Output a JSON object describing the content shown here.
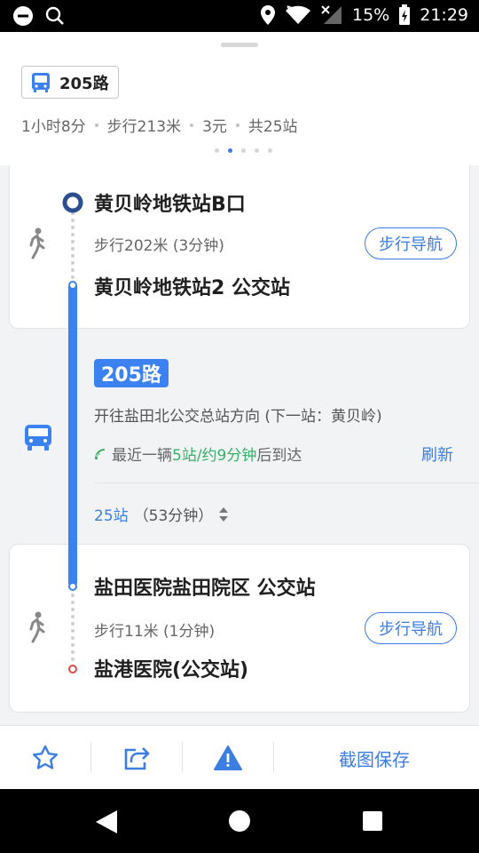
{
  "status_bar": {
    "battery": "15%",
    "time": "21:29"
  },
  "header": {
    "route_label": "205路",
    "summary": [
      "1小时8分",
      "步行213米",
      "3元",
      "共25站"
    ],
    "pager_count": 5,
    "pager_active": 1
  },
  "segment1": {
    "start_stop": "黄贝岭地铁站B口",
    "walk_info": "步行202米 (3分钟)",
    "nav_button": "步行导航",
    "end_stop": "黄贝岭地铁站2 公交站"
  },
  "bus": {
    "line": "205路",
    "direction": "开往盐田北公交总站方向 (下一站：黄贝岭)",
    "realtime_prefix": "最近一辆",
    "realtime_highlight": "5站/约9分钟",
    "realtime_suffix": "后到达",
    "refresh": "刷新",
    "stops_count": "25站",
    "duration": "（53分钟）"
  },
  "segment2": {
    "start_stop": "盐田医院盐田院区 公交站",
    "walk_info": "步行11米 (1分钟)",
    "nav_button": "步行导航",
    "end_stop": "盐港医院(公交站)"
  },
  "toolbar": {
    "save_label": "截图保存"
  },
  "colors": {
    "accent": "#3b82f0",
    "link": "#3b7de0",
    "highlight": "#38b06a",
    "end_dot": "#e04848"
  }
}
